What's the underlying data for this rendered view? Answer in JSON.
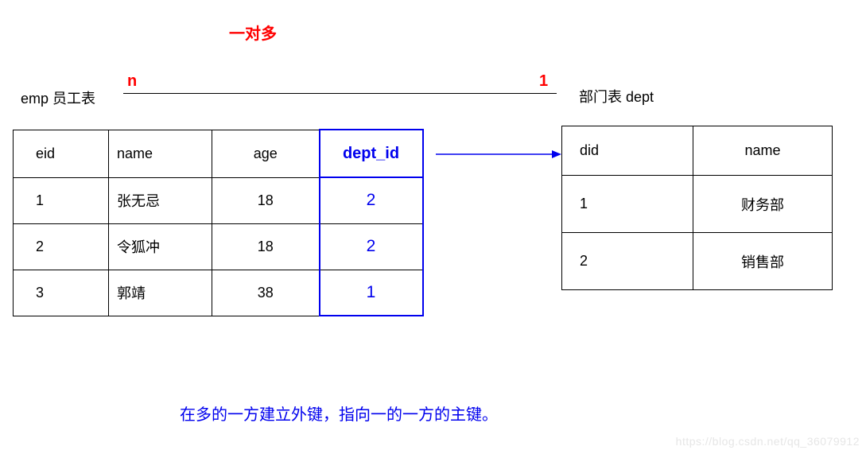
{
  "title": "一对多",
  "emp_label": "emp 员工表",
  "dept_label": "部门表 dept",
  "n_label": "n",
  "one_label": "1",
  "emp_table": {
    "headers": {
      "eid": "eid",
      "name": "name",
      "age": "age",
      "dept_id": "dept_id"
    },
    "rows": [
      {
        "eid": "1",
        "name": "张无忌",
        "age": "18",
        "dept_id": "2"
      },
      {
        "eid": "2",
        "name": "令狐冲",
        "age": "18",
        "dept_id": "2"
      },
      {
        "eid": "3",
        "name": "郭靖",
        "age": "38",
        "dept_id": "1"
      }
    ]
  },
  "dept_table": {
    "headers": {
      "did": "did",
      "name": "name"
    },
    "rows": [
      {
        "did": "1",
        "name": "财务部"
      },
      {
        "did": "2",
        "name": "销售部"
      }
    ]
  },
  "footer_note": "在多的一方建立外键，指向一的一方的主键。",
  "watermark": "https://blog.csdn.net/qq_36079912",
  "chart_data": {
    "type": "table",
    "relationship": "one-to-many",
    "many_side": "emp",
    "one_side": "dept",
    "foreign_key": "emp.dept_id",
    "references": "dept.did",
    "tables": {
      "emp": {
        "columns": [
          "eid",
          "name",
          "age",
          "dept_id"
        ],
        "rows": [
          [
            1,
            "张无忌",
            18,
            2
          ],
          [
            2,
            "令狐冲",
            18,
            2
          ],
          [
            3,
            "郭靖",
            38,
            1
          ]
        ]
      },
      "dept": {
        "columns": [
          "did",
          "name"
        ],
        "rows": [
          [
            1,
            "财务部"
          ],
          [
            2,
            "销售部"
          ]
        ]
      }
    }
  }
}
